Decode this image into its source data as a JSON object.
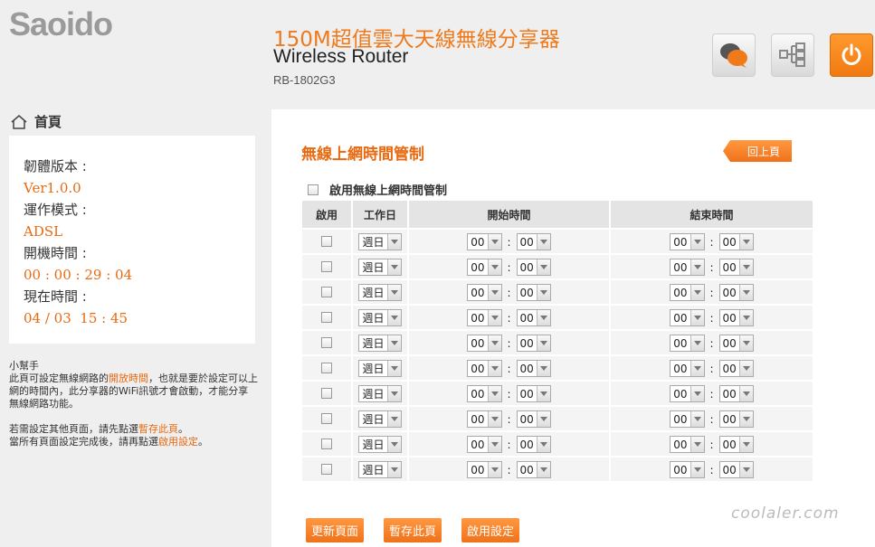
{
  "header": {
    "logo": "Saoido",
    "product_cn": "150M超值雲大天線無線分享器",
    "product_en": "Wireless Router",
    "model": "RB-1802G3",
    "icons": [
      "chat-icon",
      "network-icon",
      "power-icon"
    ]
  },
  "sidebar": {
    "home_label": "首頁",
    "info": [
      {
        "label": "韌體版本 :",
        "value": "Ver1.0.0"
      },
      {
        "label": "運作模式 :",
        "value": "ADSL"
      },
      {
        "label": "開機時間 :",
        "value": "00 : 00 : 29 : 04"
      },
      {
        "label": "現在時間 :",
        "value": "04 / 03  15 : 45"
      }
    ],
    "helper": {
      "title": "小幫手",
      "p1_a": "此頁可設定無線網路的",
      "p1_hl": "開放時間",
      "p1_b": "，也就是要於設定可以上網的時間內，此分享器的WiFi訊號才會啟動，才能分享無線網路功能。",
      "p2_a": "若需設定其他頁面，請先點選",
      "p2_hl": "暫存此頁",
      "p2_b": "。",
      "p3_a": "當所有頁面設定完成後，請再點選",
      "p3_hl": "啟用設定",
      "p3_b": "。"
    }
  },
  "main": {
    "title": "無線上網時間管制",
    "back_label": "回上頁",
    "enable_all_label": "啟用無線上網時間管制",
    "table": {
      "headers": [
        "啟用",
        "工作日",
        "開始時間",
        "結束時間"
      ],
      "rows": [
        {
          "day": "週日",
          "start_h": "00",
          "start_m": "00",
          "end_h": "00",
          "end_m": "00"
        },
        {
          "day": "週日",
          "start_h": "00",
          "start_m": "00",
          "end_h": "00",
          "end_m": "00"
        },
        {
          "day": "週日",
          "start_h": "00",
          "start_m": "00",
          "end_h": "00",
          "end_m": "00"
        },
        {
          "day": "週日",
          "start_h": "00",
          "start_m": "00",
          "end_h": "00",
          "end_m": "00"
        },
        {
          "day": "週日",
          "start_h": "00",
          "start_m": "00",
          "end_h": "00",
          "end_m": "00"
        },
        {
          "day": "週日",
          "start_h": "00",
          "start_m": "00",
          "end_h": "00",
          "end_m": "00"
        },
        {
          "day": "週日",
          "start_h": "00",
          "start_m": "00",
          "end_h": "00",
          "end_m": "00"
        },
        {
          "day": "週日",
          "start_h": "00",
          "start_m": "00",
          "end_h": "00",
          "end_m": "00"
        },
        {
          "day": "週日",
          "start_h": "00",
          "start_m": "00",
          "end_h": "00",
          "end_m": "00"
        },
        {
          "day": "週日",
          "start_h": "00",
          "start_m": "00",
          "end_h": "00",
          "end_m": "00"
        }
      ]
    },
    "buttons": {
      "refresh": "更新頁面",
      "save": "暫存此頁",
      "apply": "啟用設定"
    }
  },
  "watermark": "coolaler.com",
  "colors": {
    "accent": "#f07a1a",
    "panel_bg": "#ffffff",
    "page_bg": "#efefef"
  }
}
